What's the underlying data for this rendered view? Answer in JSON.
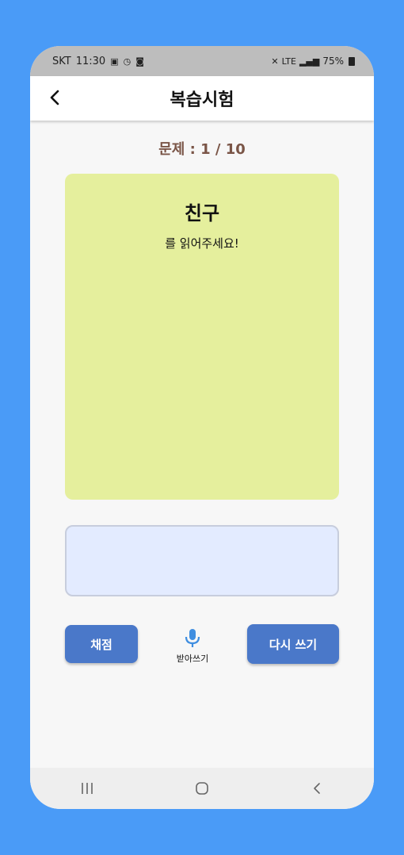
{
  "status_bar": {
    "carrier": "SKT",
    "time": "11:30",
    "battery": "75%",
    "network": "LTE"
  },
  "app_bar": {
    "title": "복습시험"
  },
  "quiz": {
    "question_counter": "문제 : 1 / 10",
    "word": "친구",
    "instruction": "를 읽어주세요!"
  },
  "answer_input": {
    "value": ""
  },
  "actions": {
    "grade_label": "채점",
    "dictation_label": "받아쓰기",
    "rewrite_label": "다시 쓰기"
  },
  "colors": {
    "background": "#4a9bf7",
    "card": "#e5ef9d",
    "answer_box": "#e3ebff",
    "button": "#4a78c9",
    "counter_text": "#7a5547",
    "mic": "#3f8ee0"
  },
  "icons": {
    "back": "chevron-left-icon",
    "mic": "microphone-icon",
    "nav_recents": "recents-icon",
    "nav_home": "home-icon",
    "nav_back": "back-icon"
  }
}
